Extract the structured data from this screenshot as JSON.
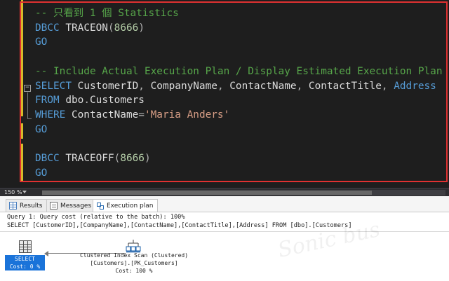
{
  "editor": {
    "lines": [
      [
        {
          "t": "-- 只看到 1 個 Statistics",
          "c": "cm"
        }
      ],
      [
        {
          "t": "DBCC ",
          "c": "kw"
        },
        {
          "t": "TRACEON",
          "c": "id"
        },
        {
          "t": "(",
          "c": "punc"
        },
        {
          "t": "8666",
          "c": "num"
        },
        {
          "t": ")",
          "c": "punc"
        }
      ],
      [
        {
          "t": "GO",
          "c": "kw"
        }
      ],
      [],
      [
        {
          "t": "-- Include Actual Execution Plan / Display Estimated Execution Plan",
          "c": "cm"
        }
      ],
      [
        {
          "t": "SELECT ",
          "c": "kw"
        },
        {
          "t": "CustomerID",
          "c": "id"
        },
        {
          "t": ", ",
          "c": "punc"
        },
        {
          "t": "CompanyName",
          "c": "id"
        },
        {
          "t": ", ",
          "c": "punc"
        },
        {
          "t": "ContactName",
          "c": "id"
        },
        {
          "t": ", ",
          "c": "punc"
        },
        {
          "t": "ContactTitle",
          "c": "id"
        },
        {
          "t": ", ",
          "c": "punc"
        },
        {
          "t": "Address",
          "c": "kw"
        }
      ],
      [
        {
          "t": "FROM ",
          "c": "kw"
        },
        {
          "t": "dbo",
          "c": "id"
        },
        {
          "t": ".",
          "c": "punc"
        },
        {
          "t": "Customers",
          "c": "id"
        }
      ],
      [
        {
          "t": "WHERE ",
          "c": "kw"
        },
        {
          "t": "ContactName",
          "c": "id"
        },
        {
          "t": "=",
          "c": "punc"
        },
        {
          "t": "'Maria Anders'",
          "c": "str"
        }
      ],
      [
        {
          "t": "GO",
          "c": "kw"
        }
      ],
      [],
      [
        {
          "t": "DBCC ",
          "c": "kw"
        },
        {
          "t": "TRACEOFF",
          "c": "id"
        },
        {
          "t": "(",
          "c": "punc"
        },
        {
          "t": "8666",
          "c": "num"
        },
        {
          "t": ")",
          "c": "punc"
        }
      ],
      [
        {
          "t": "GO",
          "c": "kw"
        }
      ]
    ]
  },
  "status": {
    "zoom": "150 %"
  },
  "tabs": [
    {
      "label": "Results",
      "icon": "grid-icon",
      "active": false
    },
    {
      "label": "Messages",
      "icon": "messages-icon",
      "active": false
    },
    {
      "label": "Execution plan",
      "icon": "execution-plan-icon",
      "active": true
    }
  ],
  "plan": {
    "query_cost": "Query 1: Query cost (relative to the batch): 100%",
    "query_text": "SELECT [CustomerID],[CompanyName],[ContactName],[ContactTitle],[Address] FROM [dbo].[Customers]",
    "select_op": {
      "name": "SELECT",
      "cost": "Cost: 0 %",
      "icon": "select-operator-icon"
    },
    "scan_op": {
      "name": "Clustered Index Scan (Clustered)",
      "object": "[Customers].[PK_Customers]",
      "cost": "Cost: 100 %",
      "icon": "clustered-index-scan-icon"
    }
  },
  "colors": {
    "highlight_frame": "#e03131",
    "selected_operator": "#1a73d9"
  }
}
